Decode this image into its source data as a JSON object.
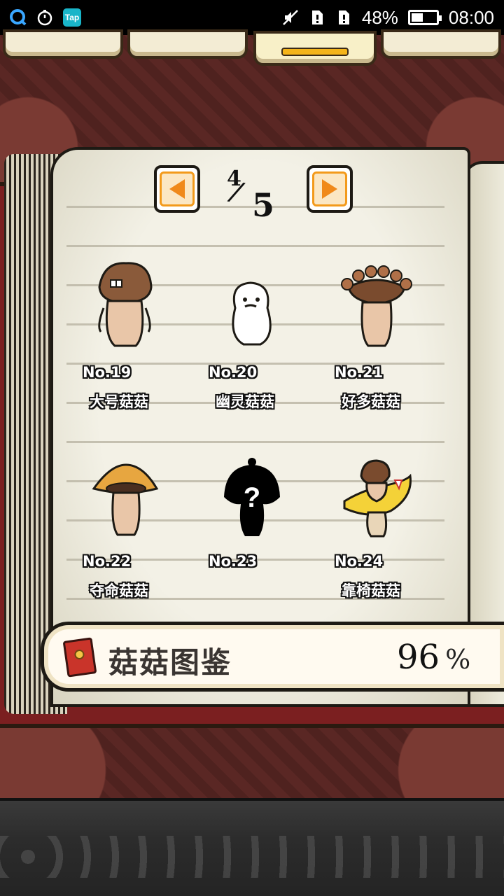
{
  "status_bar": {
    "battery": "48%",
    "time": "08:00",
    "app_badge": "Tap",
    "battery_level": 0.48
  },
  "book": {
    "page_current": "4",
    "page_total": "5",
    "entries": [
      {
        "number": "No.19",
        "name": "大号菇菇",
        "icon": "big-mushroom-icon"
      },
      {
        "number": "No.20",
        "name": "幽灵菇菇",
        "icon": "ghost-mushroom-icon"
      },
      {
        "number": "No.21",
        "name": "好多菇菇",
        "icon": "many-mushrooms-icon"
      },
      {
        "number": "No.22",
        "name": "夺命菇菇",
        "icon": "deadly-mushroom-icon"
      },
      {
        "number": "No.23",
        "name": "",
        "icon": "unknown-silhouette-icon"
      },
      {
        "number": "No.24",
        "name": "靠椅菇菇",
        "icon": "lounging-mushroom-icon"
      }
    ]
  },
  "summary": {
    "title": "菇菇图鉴",
    "percent": "96",
    "unit": "%"
  },
  "colors": {
    "accent_orange": "#f0891a",
    "book_red": "#7b1f20",
    "page_paper": "#f3f1e6"
  }
}
